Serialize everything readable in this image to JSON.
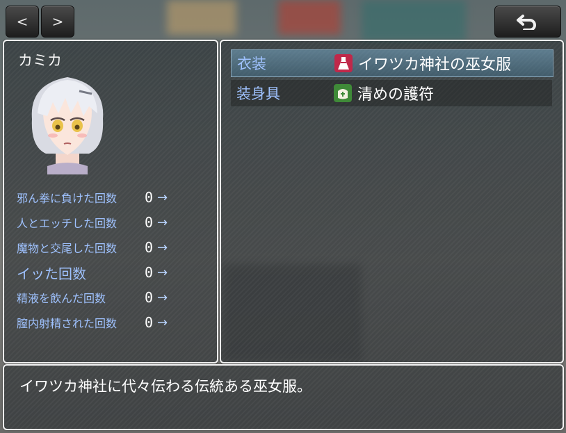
{
  "nav": {
    "prev_label": "<",
    "next_label": ">"
  },
  "colors": {
    "accent_blue": "#9fc2ff",
    "window_border": "#f2f2f2",
    "costume_icon": "#c0284a",
    "accessory_icon": "#3f8a38"
  },
  "character": {
    "name": "カミカ",
    "stats": [
      {
        "label": "邪ん拳に負けた回数",
        "value": "0",
        "arrow": "→"
      },
      {
        "label": "人とエッチした回数",
        "value": "0",
        "arrow": "→"
      },
      {
        "label": "魔物と交尾した回数",
        "value": "0",
        "arrow": "→"
      },
      {
        "label": "イッた回数",
        "value": "0",
        "arrow": "→"
      },
      {
        "label": "精液を飲んだ回数",
        "value": "0",
        "arrow": "→"
      },
      {
        "label": "膣内射精された回数",
        "value": "0",
        "arrow": "→"
      }
    ]
  },
  "equipment": {
    "slots": [
      {
        "type": "衣装",
        "item": "イワツカ神社の巫女服",
        "icon": "dress-icon",
        "selected": true
      },
      {
        "type": "装身具",
        "item": "清めの護符",
        "icon": "charm-icon",
        "selected": false
      }
    ]
  },
  "help": {
    "text": "イワツカ神社に代々伝わる伝統ある巫女服。"
  }
}
